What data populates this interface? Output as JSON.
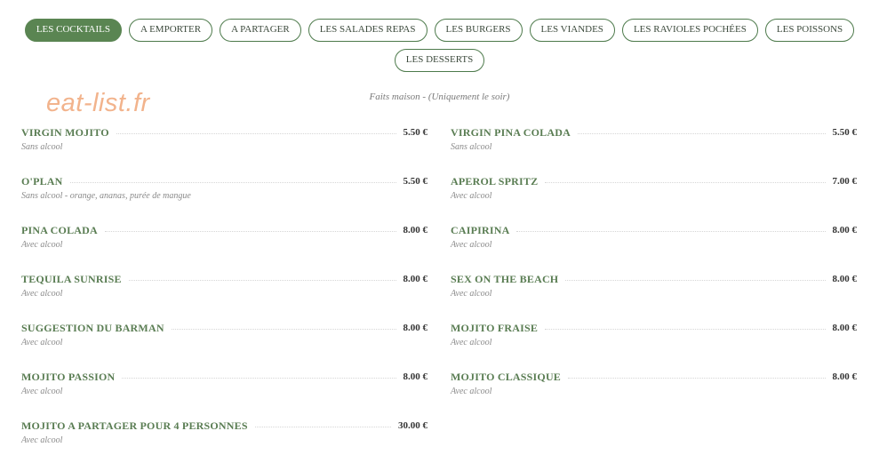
{
  "tabs_row1": [
    {
      "label": "LES COCKTAILS",
      "active": true
    },
    {
      "label": "A EMPORTER"
    },
    {
      "label": "A PARTAGER"
    },
    {
      "label": "LES SALADES REPAS"
    },
    {
      "label": "LES BURGERS"
    },
    {
      "label": "LES VIANDES"
    },
    {
      "label": "LES RAVIOLES POCHÉES"
    },
    {
      "label": "LES POISSONS"
    }
  ],
  "tabs_row2": [
    {
      "label": "LES DESSERTS"
    }
  ],
  "watermark": "eat-list.fr",
  "subtitle": "Faits maison - (Uniquement le soir)",
  "menu_left": [
    {
      "name": "VIRGIN MOJITO",
      "price": "5.50 €",
      "desc": "Sans alcool"
    },
    {
      "name": "O'PLAN",
      "price": "5.50 €",
      "desc": "Sans alcool - orange, ananas, purée de mangue"
    },
    {
      "name": "PINA COLADA",
      "price": "8.00 €",
      "desc": "Avec alcool"
    },
    {
      "name": "TEQUILA SUNRISE",
      "price": "8.00 €",
      "desc": "Avec alcool"
    },
    {
      "name": "SUGGESTION DU BARMAN",
      "price": "8.00 €",
      "desc": "Avec alcool"
    },
    {
      "name": "MOJITO PASSION",
      "price": "8.00 €",
      "desc": "Avec alcool"
    },
    {
      "name": "MOJITO A PARTAGER POUR 4 PERSONNES",
      "price": "30.00 €",
      "desc": "Avec alcool"
    }
  ],
  "menu_right": [
    {
      "name": "VIRGIN PINA COLADA",
      "price": "5.50 €",
      "desc": "Sans alcool"
    },
    {
      "name": "APEROL SPRITZ",
      "price": "7.00 €",
      "desc": "Avec alcool"
    },
    {
      "name": "CAIPIRINA",
      "price": "8.00 €",
      "desc": "Avec alcool"
    },
    {
      "name": "SEX ON THE BEACH",
      "price": "8.00 €",
      "desc": "Avec alcool"
    },
    {
      "name": "MOJITO FRAISE",
      "price": "8.00 €",
      "desc": "Avec alcool"
    },
    {
      "name": "MOJITO CLASSIQUE",
      "price": "8.00 €",
      "desc": "Avec alcool"
    }
  ],
  "colors": {
    "accent": "#5a8552",
    "item_name": "#5a7d53",
    "watermark": "#f2b38c"
  }
}
